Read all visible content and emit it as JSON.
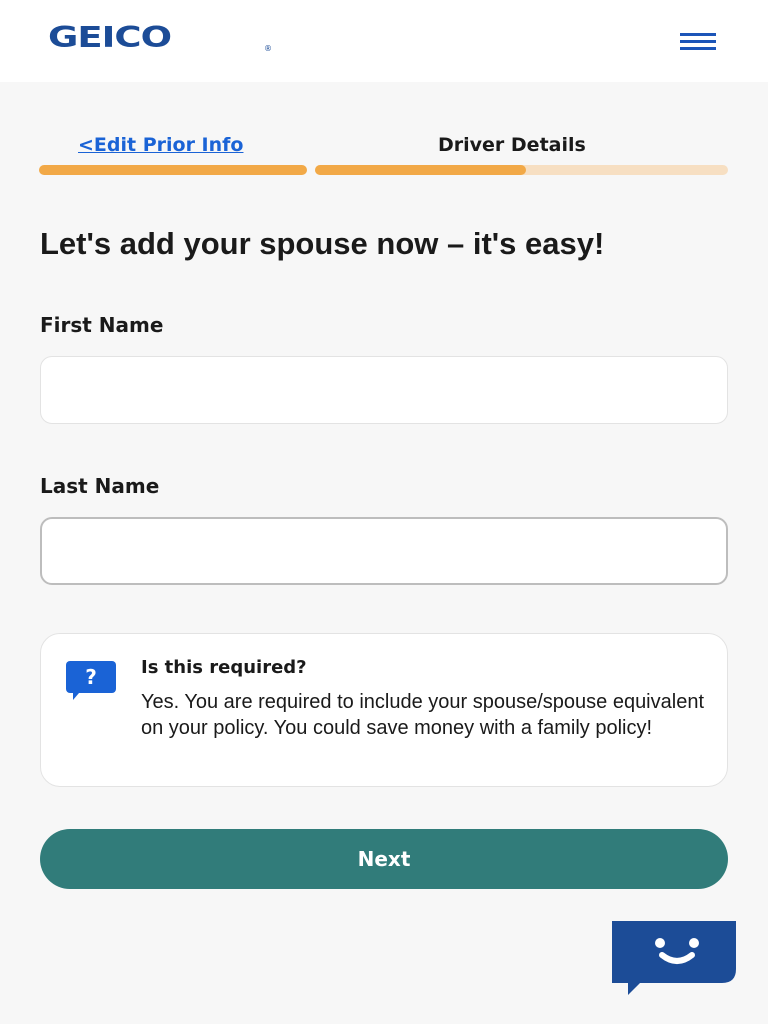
{
  "header": {
    "logo_text": "GEICO",
    "logo_reg": "®",
    "menu_icon": "hamburger-menu-icon"
  },
  "progress": {
    "back_link": "<Edit Prior Info",
    "step_title": "Driver Details",
    "step1_complete": 1.0,
    "step2_complete": 0.5,
    "colors": {
      "fill": "#f2a947",
      "track": "#f7dfc2"
    }
  },
  "form": {
    "heading": "Let's add your spouse now – it's easy!",
    "first_name_label": "First Name",
    "first_name_value": "",
    "last_name_label": "Last Name",
    "last_name_value": ""
  },
  "info": {
    "icon": "question-bubble-icon",
    "title": "Is this required?",
    "text": "Yes. You are required to include your spouse/spouse equivalent on your policy. You could save money with a family policy!"
  },
  "actions": {
    "next_label": "Next",
    "next_color": "#317c7a"
  },
  "chat": {
    "icon": "chat-bot-icon",
    "color": "#1c4c97"
  },
  "colors": {
    "brand": "#1c4c97",
    "link": "#1a63d6",
    "background": "#f7f7f7"
  }
}
